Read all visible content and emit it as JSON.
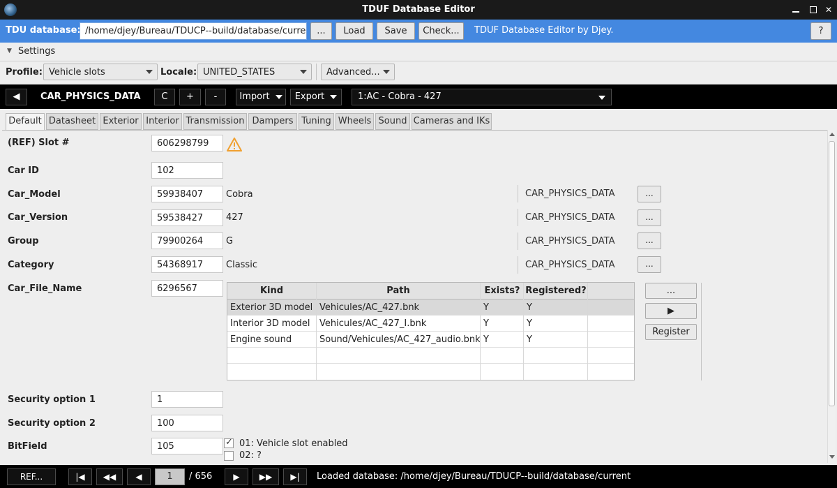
{
  "window": {
    "title": "TDUF Database Editor"
  },
  "dbbar": {
    "label": "TDU database:",
    "path": "/home/djey/Bureau/TDUCP--build/database/current",
    "browse_label": "...",
    "load_label": "Load",
    "save_label": "Save",
    "check_label": "Check...",
    "credit": "TDUF Database Editor by Djey.",
    "help_label": "?"
  },
  "settings": {
    "label": "Settings"
  },
  "profilebar": {
    "profile_label": "Profile:",
    "profile_value": "Vehicle slots",
    "locale_label": "Locale:",
    "locale_value": "UNITED_STATES",
    "advanced_label": "Advanced..."
  },
  "topicbar": {
    "back_label": "◀",
    "topic": "CAR_PHYSICS_DATA",
    "c_label": "C",
    "add_label": "+",
    "remove_label": "-",
    "import_label": "Import",
    "export_label": "Export",
    "entry_value": "1:AC - Cobra - 427"
  },
  "tabs": [
    "Default",
    "Datasheet",
    "Exterior",
    "Interior",
    "Transmission",
    "Dampers",
    "Tuning",
    "Wheels",
    "Sound",
    "Cameras and IKs"
  ],
  "fields": {
    "slot": {
      "label": "(REF) Slot #",
      "value": "606298799"
    },
    "car_id": {
      "label": "Car ID",
      "value": "102"
    },
    "car_model": {
      "label": "Car_Model",
      "value": "59938407",
      "resolved": "Cobra",
      "topic": "CAR_PHYSICS_DATA",
      "btn": "..."
    },
    "car_version": {
      "label": "Car_Version",
      "value": "59538427",
      "resolved": "427",
      "topic": "CAR_PHYSICS_DATA",
      "btn": "..."
    },
    "group": {
      "label": "Group",
      "value": "79900264",
      "resolved": "G",
      "topic": "CAR_PHYSICS_DATA",
      "btn": "..."
    },
    "category": {
      "label": "Category",
      "value": "54368917",
      "resolved": "Classic",
      "topic": "CAR_PHYSICS_DATA",
      "btn": "..."
    },
    "car_file_name": {
      "label": "Car_File_Name",
      "value": "6296567"
    },
    "security1": {
      "label": "Security option 1",
      "value": "1"
    },
    "security2": {
      "label": "Security option 2",
      "value": "100"
    },
    "bitfield": {
      "label": "BitField",
      "value": "105"
    }
  },
  "resources_table": {
    "headers": [
      "Kind",
      "Path",
      "Exists?",
      "Registered?"
    ],
    "rows": [
      {
        "kind": "Exterior 3D model",
        "path": "Vehicules/AC_427.bnk",
        "exists": "Y",
        "registered": "Y"
      },
      {
        "kind": "Interior 3D model",
        "path": "Vehicules/AC_427_I.bnk",
        "exists": "Y",
        "registered": "Y"
      },
      {
        "kind": "Engine sound",
        "path": "Sound/Vehicules/AC_427_audio.bnk",
        "exists": "Y",
        "registered": "Y"
      }
    ],
    "browse_label": "...",
    "play_label": "▶",
    "register_label": "Register"
  },
  "bitfield_flags": [
    {
      "label": "01: Vehicle slot enabled",
      "checked": true
    },
    {
      "label": "02: ?",
      "checked": false
    }
  ],
  "bottombar": {
    "ref_label": "REF...",
    "first_label": "|◀",
    "prev_fast_label": "◀◀",
    "prev_label": "◀",
    "page": "1",
    "total": "/ 656",
    "next_label": "▶",
    "next_fast_label": "▶▶",
    "last_label": "▶|",
    "status": "Loaded database: /home/djey/Bureau/TDUCP--build/database/current"
  },
  "colors": {
    "dbbar": "#4488e0",
    "topicbar": "#000000",
    "warning": "#f0a030"
  }
}
